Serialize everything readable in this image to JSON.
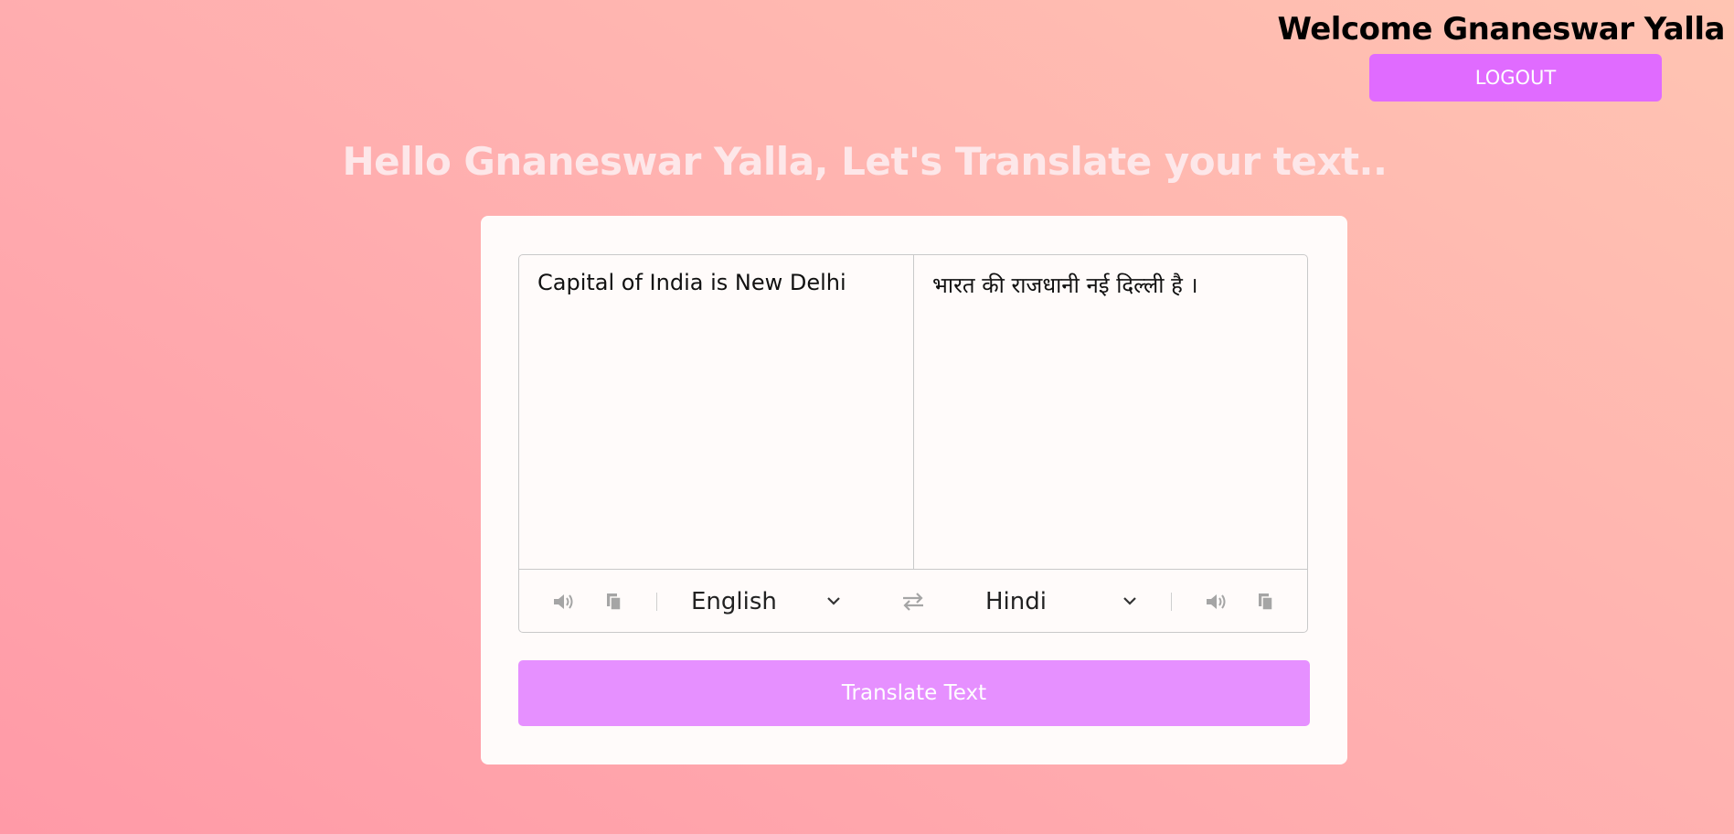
{
  "header": {
    "welcome_text": "Welcome Gnaneswar Yalla",
    "logout_label": "LOGOUT"
  },
  "main": {
    "heading": "Hello Gnaneswar Yalla, Let's Translate your text.."
  },
  "translator": {
    "source_text": "Capital of India is New Delhi",
    "target_text": "भारत की राजधानी नई दिल्ली है ।",
    "source_language": "English",
    "target_language": "Hindi",
    "translate_label": "Translate Text"
  },
  "icons": {
    "speak": "speaker-icon",
    "copy": "copy-icon",
    "swap": "swap-icon",
    "dropdown": "chevron-down-icon"
  },
  "colors": {
    "logout_bg": "#e06bff",
    "translate_bg": "#e690ff",
    "card_bg": "#fffbfa"
  }
}
